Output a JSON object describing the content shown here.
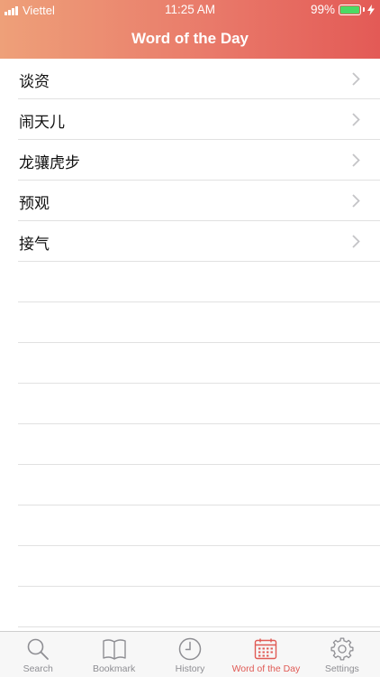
{
  "status_bar": {
    "carrier": "Viettel",
    "time": "11:25 AM",
    "battery": "99%",
    "battery_level": 0.99
  },
  "nav": {
    "title": "Word of the Day"
  },
  "words": [
    {
      "label": "谈资"
    },
    {
      "label": "闹天儿"
    },
    {
      "label": "龙骧虎步"
    },
    {
      "label": "预观"
    },
    {
      "label": "接气"
    }
  ],
  "tabs": [
    {
      "label": "Search",
      "icon": "search-icon"
    },
    {
      "label": "Bookmark",
      "icon": "bookmark-icon"
    },
    {
      "label": "History",
      "icon": "clock-icon"
    },
    {
      "label": "Word of the Day",
      "icon": "calendar-icon",
      "active": true
    },
    {
      "label": "Settings",
      "icon": "gear-icon"
    }
  ],
  "colors": {
    "accent": "#e05a55",
    "header_start": "#eea079",
    "header_end": "#e35a56",
    "battery": "#4cd964"
  }
}
